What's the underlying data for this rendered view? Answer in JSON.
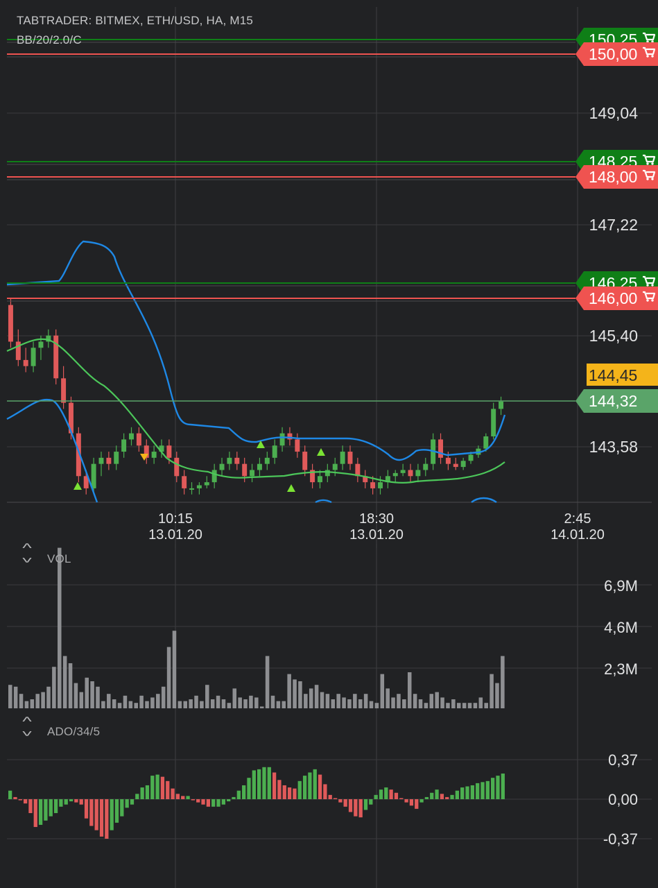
{
  "header": {
    "title": "TABTRADER: BITMEX, ETH/USD, HA, M15",
    "indicator": "BB/20/2.0/C"
  },
  "price_axis": {
    "ticks": [
      "149,04",
      "147,22",
      "145,40",
      "143,58"
    ]
  },
  "orders": [
    {
      "price": "150,25",
      "color": "#0f7f17",
      "side": "buy"
    },
    {
      "price": "150,00",
      "color": "#ef5350",
      "side": "sell"
    },
    {
      "price": "148,25",
      "color": "#0f7f17",
      "side": "buy"
    },
    {
      "price": "148,00",
      "color": "#ef5350",
      "side": "sell"
    },
    {
      "price": "146,25",
      "color": "#0f7f17",
      "side": "buy"
    },
    {
      "price": "146,00",
      "color": "#ef5350",
      "side": "sell"
    }
  ],
  "last_price": {
    "value": "144,32",
    "color": "#5aa469"
  },
  "alert_price": {
    "value": "144,45",
    "color": "#f4b41a"
  },
  "time_axis": [
    {
      "time": "10:15",
      "date": "13.01.20"
    },
    {
      "time": "18:30",
      "date": "13.01.20"
    },
    {
      "time": "2:45",
      "date": "14.01.20"
    }
  ],
  "volume_panel": {
    "label": "VOL",
    "ticks": [
      "6,9M",
      "4,6M",
      "2,3M"
    ]
  },
  "ado_panel": {
    "label": "ADO/34/5",
    "ticks": [
      "0,37",
      "0,00",
      "-0,37"
    ]
  },
  "colors": {
    "background": "#212224",
    "grid": "#3a3b3e",
    "bull": "#4caf50",
    "bear": "#e05a5a",
    "bb_band": "#1e88e5",
    "bb_mid": "#4cc75a"
  },
  "icons": {
    "order_tag": "cart-icon",
    "collapse": "chevron-up-icon",
    "expand": "chevron-down-icon"
  },
  "chart_data": [
    {
      "type": "candlestick",
      "title": "TABTRADER: BITMEX, ETH/USD, HA, M15",
      "ylim": [
        142.8,
        150.6
      ],
      "grid": true,
      "candles": [
        [
          145.9,
          146.0,
          145.2,
          145.3
        ],
        [
          145.3,
          145.5,
          144.9,
          145.0
        ],
        [
          145.0,
          145.2,
          144.8,
          144.9
        ],
        [
          144.9,
          145.3,
          144.8,
          145.2
        ],
        [
          145.2,
          145.4,
          145.0,
          145.3
        ],
        [
          145.3,
          145.5,
          145.2,
          145.4
        ],
        [
          145.4,
          145.5,
          144.6,
          144.7
        ],
        [
          144.7,
          144.9,
          144.2,
          144.3
        ],
        [
          144.3,
          144.4,
          143.7,
          143.8
        ],
        [
          143.8,
          143.9,
          143.0,
          143.1
        ],
        [
          143.1,
          143.2,
          142.8,
          142.9
        ],
        [
          142.9,
          143.4,
          142.8,
          143.3
        ],
        [
          143.3,
          143.5,
          143.1,
          143.4
        ],
        [
          143.4,
          143.5,
          143.2,
          143.3
        ],
        [
          143.3,
          143.6,
          143.2,
          143.5
        ],
        [
          143.5,
          143.8,
          143.4,
          143.7
        ],
        [
          143.7,
          143.9,
          143.6,
          143.8
        ],
        [
          143.8,
          143.9,
          143.5,
          143.6
        ],
        [
          143.6,
          143.7,
          143.3,
          143.4
        ],
        [
          143.4,
          143.6,
          143.3,
          143.5
        ],
        [
          143.5,
          143.7,
          143.4,
          143.6
        ],
        [
          143.6,
          143.7,
          143.3,
          143.4
        ],
        [
          143.4,
          143.5,
          143.0,
          143.1
        ],
        [
          143.1,
          143.2,
          142.8,
          142.9
        ],
        [
          142.9,
          143.0,
          142.8,
          142.9
        ],
        [
          142.9,
          143.0,
          142.8,
          142.95
        ],
        [
          142.95,
          143.1,
          142.9,
          143.0
        ],
        [
          143.0,
          143.3,
          142.9,
          143.2
        ],
        [
          143.2,
          143.4,
          143.1,
          143.3
        ],
        [
          143.3,
          143.5,
          143.2,
          143.4
        ],
        [
          143.4,
          143.5,
          143.2,
          143.3
        ],
        [
          143.3,
          143.4,
          143.0,
          143.1
        ],
        [
          143.1,
          143.3,
          143.0,
          143.2
        ],
        [
          143.2,
          143.4,
          143.1,
          143.3
        ],
        [
          143.3,
          143.5,
          143.2,
          143.4
        ],
        [
          143.4,
          143.7,
          143.3,
          143.6
        ],
        [
          143.6,
          143.9,
          143.5,
          143.8
        ],
        [
          143.8,
          143.9,
          143.6,
          143.7
        ],
        [
          143.7,
          143.8,
          143.4,
          143.5
        ],
        [
          143.5,
          143.6,
          143.1,
          143.2
        ],
        [
          143.2,
          143.3,
          142.9,
          143.0
        ],
        [
          143.0,
          143.2,
          142.9,
          143.1
        ],
        [
          143.1,
          143.3,
          143.0,
          143.2
        ],
        [
          143.2,
          143.4,
          143.1,
          143.3
        ],
        [
          143.3,
          143.6,
          143.2,
          143.5
        ],
        [
          143.5,
          143.6,
          143.2,
          143.3
        ],
        [
          143.3,
          143.4,
          143.0,
          143.1
        ],
        [
          143.1,
          143.2,
          142.9,
          143.0
        ],
        [
          143.0,
          143.1,
          142.8,
          142.9
        ],
        [
          142.9,
          143.1,
          142.8,
          143.0
        ],
        [
          143.0,
          143.2,
          142.9,
          143.1
        ],
        [
          143.1,
          143.2,
          143.0,
          143.15
        ],
        [
          143.15,
          143.3,
          143.1,
          143.2
        ],
        [
          143.2,
          143.3,
          143.0,
          143.1
        ],
        [
          143.1,
          143.3,
          143.0,
          143.2
        ],
        [
          143.2,
          143.4,
          143.1,
          143.3
        ],
        [
          143.3,
          143.8,
          143.2,
          143.7
        ],
        [
          143.7,
          143.8,
          143.3,
          143.4
        ],
        [
          143.4,
          143.5,
          143.2,
          143.3
        ],
        [
          143.3,
          143.4,
          143.2,
          143.25
        ],
        [
          143.25,
          143.4,
          143.2,
          143.35
        ],
        [
          143.35,
          143.5,
          143.3,
          143.45
        ],
        [
          143.45,
          143.6,
          143.4,
          143.55
        ],
        [
          143.55,
          143.8,
          143.5,
          143.75
        ],
        [
          143.75,
          144.3,
          143.7,
          144.2
        ],
        [
          144.2,
          144.4,
          144.1,
          144.32
        ]
      ]
    },
    {
      "type": "bar",
      "title": "VOL",
      "ylim": [
        0,
        9000000
      ],
      "values": [
        1.3,
        1.2,
        0.8,
        0.4,
        0.5,
        0.8,
        0.9,
        1.2,
        2.3,
        8.9,
        2.9,
        2.5,
        1.4,
        0.9,
        1.7,
        1.5,
        1.2,
        0.4,
        0.8,
        0.5,
        0.3,
        0.7,
        0.4,
        0.3,
        0.7,
        0.4,
        0.6,
        0.8,
        1.2,
        3.4,
        4.3,
        0.4,
        0.4,
        0.5,
        0.7,
        0.4,
        1.3,
        0.5,
        0.7,
        0.5,
        0.3,
        1.1,
        0.6,
        0.5,
        0.7,
        0.6,
        0.1,
        2.9,
        0.7,
        0.4,
        0.4,
        1.9,
        1.6,
        1.5,
        0.8,
        1.1,
        1.3,
        0.9,
        0.8,
        0.5,
        0.8,
        0.6,
        0.5,
        0.8,
        0.5,
        0.8,
        0.4,
        0.3,
        1.9,
        1.1,
        0.6,
        0.8,
        0.5,
        2.0,
        0.8,
        0.5,
        0.3,
        0.8,
        0.9,
        0.6,
        0.3,
        0.5,
        0.3,
        0.3,
        0.3,
        0.3,
        0.6,
        0.3,
        1.9,
        1.4,
        2.9
      ]
    },
    {
      "type": "bar",
      "title": "ADO/34/5",
      "ylim": [
        -0.5,
        0.5
      ],
      "values": [
        0.08,
        0.02,
        -0.01,
        -0.04,
        -0.13,
        -0.26,
        -0.24,
        -0.2,
        -0.16,
        -0.13,
        -0.07,
        -0.05,
        -0.02,
        -0.03,
        -0.05,
        -0.18,
        -0.25,
        -0.29,
        -0.35,
        -0.37,
        -0.29,
        -0.22,
        -0.16,
        -0.08,
        -0.05,
        0.05,
        0.11,
        0.13,
        0.22,
        0.23,
        0.21,
        0.17,
        0.1,
        0.05,
        0.03,
        0.03,
        -0.01,
        -0.03,
        -0.05,
        -0.07,
        -0.07,
        -0.07,
        -0.05,
        -0.02,
        0.02,
        0.08,
        0.13,
        0.2,
        0.27,
        0.28,
        0.3,
        0.3,
        0.25,
        0.18,
        0.13,
        0.11,
        0.1,
        0.17,
        0.22,
        0.25,
        0.28,
        0.23,
        0.14,
        0.04,
        0.01,
        -0.03,
        -0.07,
        -0.12,
        -0.16,
        -0.17,
        -0.1,
        -0.05,
        0.04,
        0.09,
        0.11,
        0.09,
        0.06,
        0.01,
        -0.03,
        -0.06,
        -0.09,
        -0.03,
        0.02,
        0.06,
        0.09,
        0.05,
        0.02,
        0.04,
        0.08,
        0.11,
        0.12,
        0.13,
        0.15,
        0.16,
        0.17,
        0.2,
        0.22,
        0.24
      ]
    }
  ]
}
